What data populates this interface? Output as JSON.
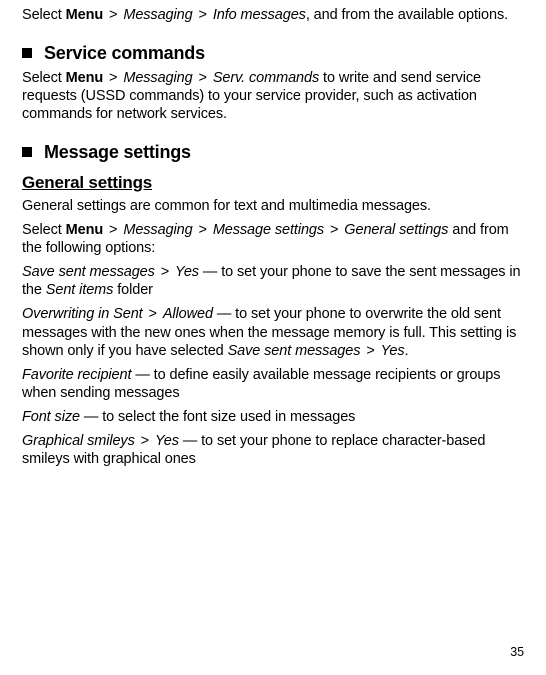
{
  "top_line": {
    "select": "Select ",
    "menu": "Menu",
    "gt1": " > ",
    "messaging": "Messaging",
    "gt2": " > ",
    "info": "Info messages",
    "tail": ", and from the available options."
  },
  "service_commands": {
    "heading": "Service commands",
    "p": {
      "select": "Select ",
      "menu": "Menu",
      "gt1": " > ",
      "messaging": "Messaging",
      "gt2": " > ",
      "serv": "Serv. commands",
      "tail": " to write and send service requests (USSD commands) to your service provider, such as activation commands for network services."
    }
  },
  "message_settings": {
    "heading": "Message settings",
    "general": {
      "heading": "General settings",
      "intro": "General settings are common for text and multimedia messages.",
      "path": {
        "select": "Select ",
        "menu": "Menu",
        "gt1": " > ",
        "messaging": "Messaging",
        "gt2": " > ",
        "msgset": "Message settings",
        "gt3": " > ",
        "general": "General settings",
        "tail": " and from the following options:"
      },
      "opts": {
        "save_sent": {
          "label": "Save sent messages",
          "gt": " > ",
          "val": "Yes",
          "dash": " — to set your phone to save the sent messages in the ",
          "sent_items": "Sent items",
          "tail": " folder"
        },
        "overwriting": {
          "label": "Overwriting in Sent",
          "gt": " > ",
          "val": "Allowed",
          "dash": " — to set your phone to overwrite the old sent messages with the new ones when the message memory is full. This setting is shown only if you have selected ",
          "ref": "Save sent messages",
          "gt2": " > ",
          "refval": "Yes",
          "period": "."
        },
        "favorite": {
          "label": "Favorite recipient",
          "dash": " — to define easily available message recipients or groups when sending messages"
        },
        "fontsize": {
          "label": "Font size",
          "dash": " — to select the font size used in messages"
        },
        "smileys": {
          "label": "Graphical smileys",
          "gt": " > ",
          "val": "Yes",
          "dash": " — to set your phone to replace character-based smileys with graphical ones"
        }
      }
    }
  },
  "page_number": "35"
}
